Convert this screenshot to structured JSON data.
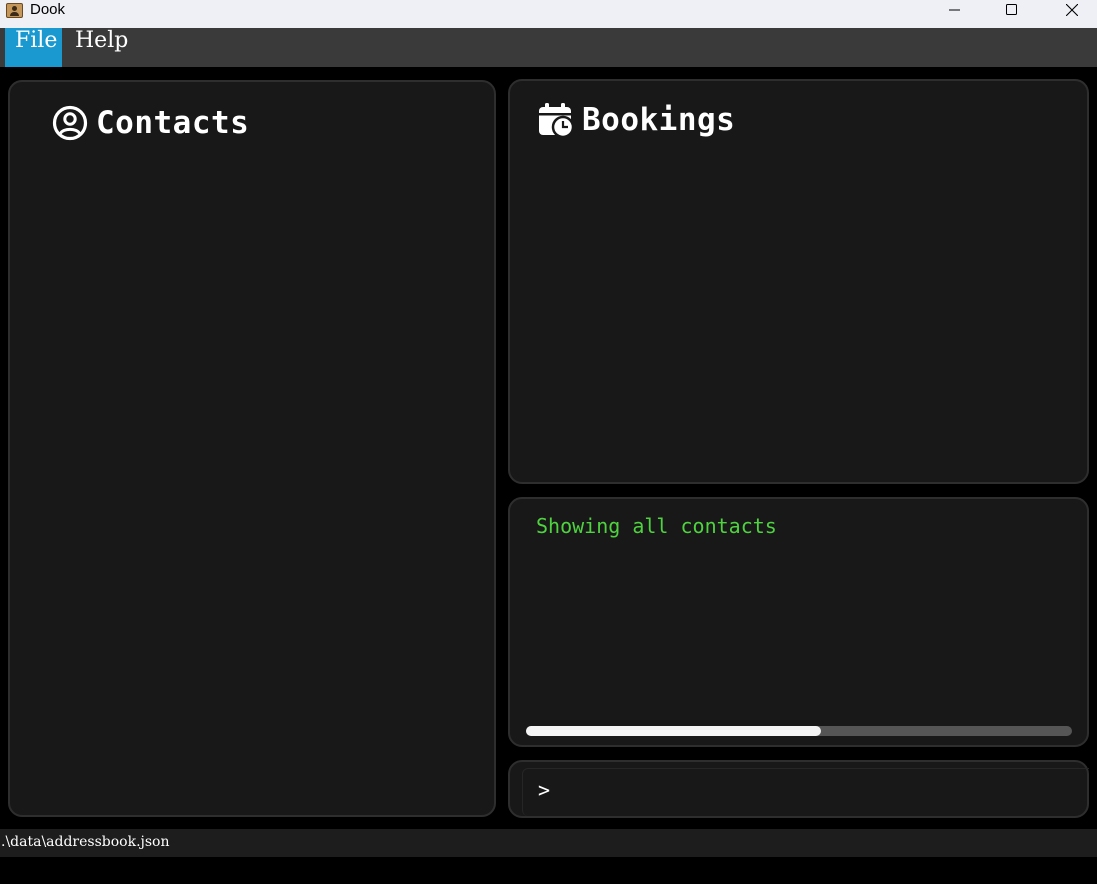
{
  "window": {
    "title": "Dook",
    "app_icon": "addressbook-app-icon",
    "controls": [
      "minimize-icon",
      "maximize-icon",
      "close-icon"
    ]
  },
  "menu": {
    "items": [
      {
        "label": "File",
        "active": true
      },
      {
        "label": "Help",
        "active": false
      }
    ],
    "active_color": "#1a98d0"
  },
  "contacts": {
    "title": "Contacts",
    "icon": "user-circle-icon",
    "items": []
  },
  "bookings": {
    "title": "Bookings",
    "icon": "calendar-clock-icon",
    "items": []
  },
  "result": {
    "text": "Showing all contacts",
    "text_color": "#4fd23f",
    "scroll_position": 0.54
  },
  "command": {
    "prompt": ">",
    "value": ""
  },
  "status": {
    "path": ".\\data\\addressbook.json"
  }
}
